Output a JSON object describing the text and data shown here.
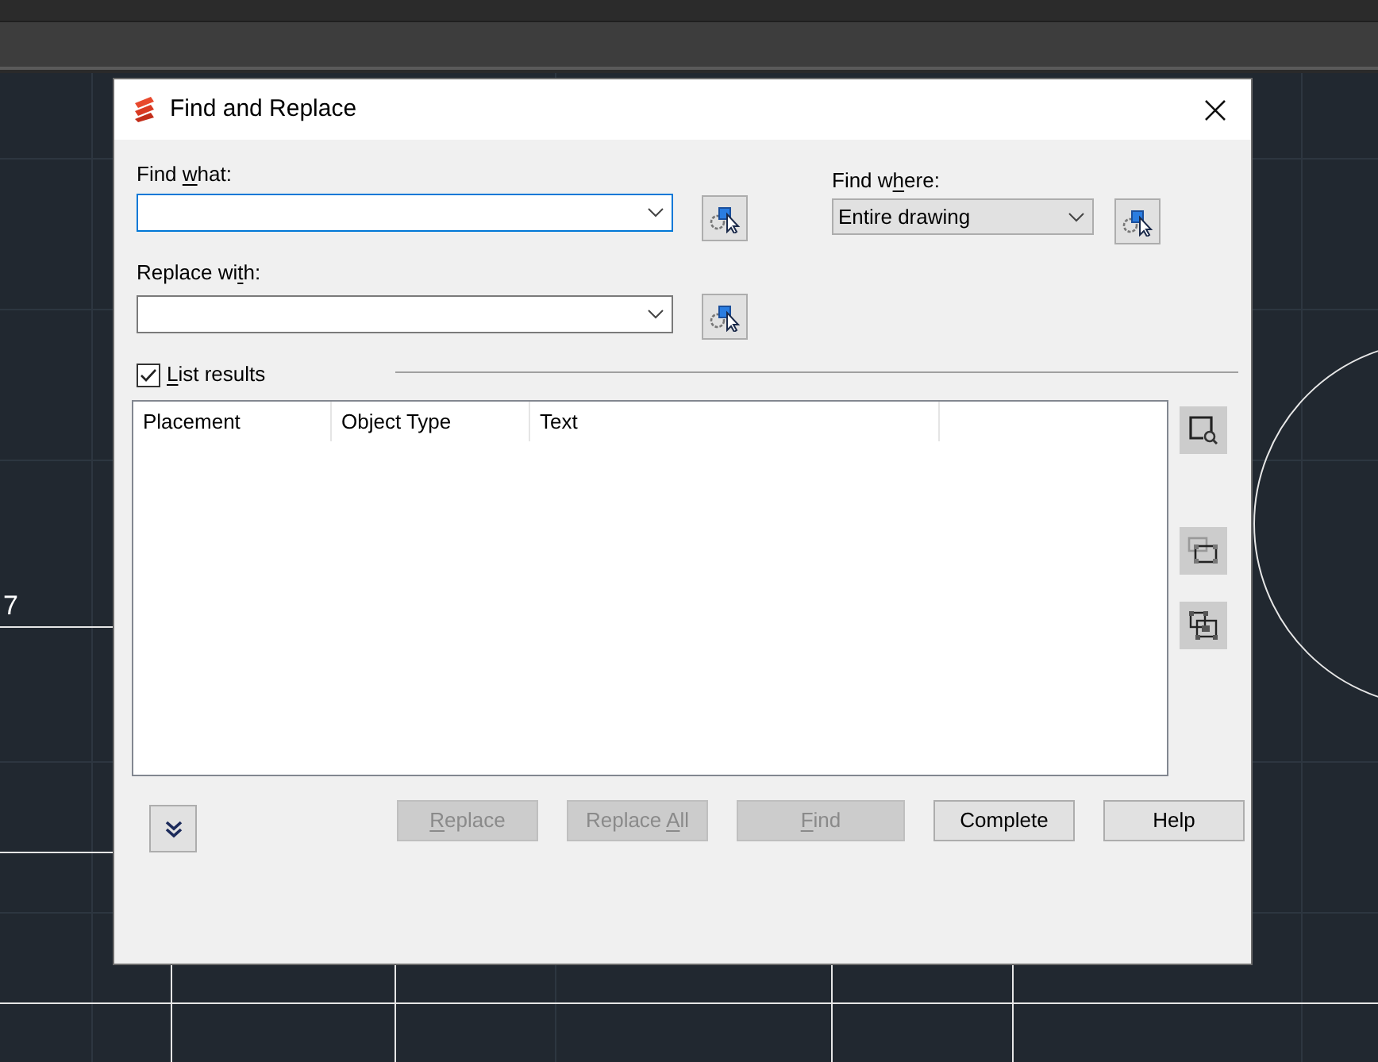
{
  "canvas": {
    "label": "7"
  },
  "dialog": {
    "title": "Find and Replace",
    "find_what": {
      "label": [
        {
          "text": "Find "
        },
        {
          "text": "w",
          "underline": true
        },
        {
          "text": "hat:"
        }
      ]
    },
    "replace_with": {
      "label": [
        {
          "text": "Replace "
        },
        {
          "text": "wi"
        },
        {
          "text": "t",
          "underline": true
        },
        {
          "text": "h:"
        }
      ]
    },
    "find_where": {
      "label": [
        {
          "text": "Find w"
        },
        {
          "text": "h",
          "underline": true
        },
        {
          "text": "ere:"
        }
      ],
      "value": "Entire drawing"
    },
    "list_results": {
      "label": [
        {
          "text": "L",
          "underline": true
        },
        {
          "text": "ist results"
        }
      ],
      "checked": true
    },
    "results_table": {
      "columns": [
        "Placement",
        "Object Type",
        "Text"
      ]
    },
    "buttons": [
      {
        "label": [
          {
            "text": "R",
            "underline": true
          },
          {
            "text": "eplace"
          }
        ],
        "disabled": true
      },
      {
        "label": [
          {
            "text": "Replace "
          },
          {
            "text": "A",
            "underline": true
          },
          {
            "text": "ll"
          }
        ],
        "disabled": true
      },
      {
        "label": [
          {
            "text": "F",
            "underline": true
          },
          {
            "text": "ind"
          }
        ],
        "disabled": true
      },
      {
        "label": [
          {
            "text": "Complete"
          }
        ],
        "disabled": false
      },
      {
        "label": [
          {
            "text": "Help"
          }
        ],
        "disabled": false
      }
    ]
  }
}
